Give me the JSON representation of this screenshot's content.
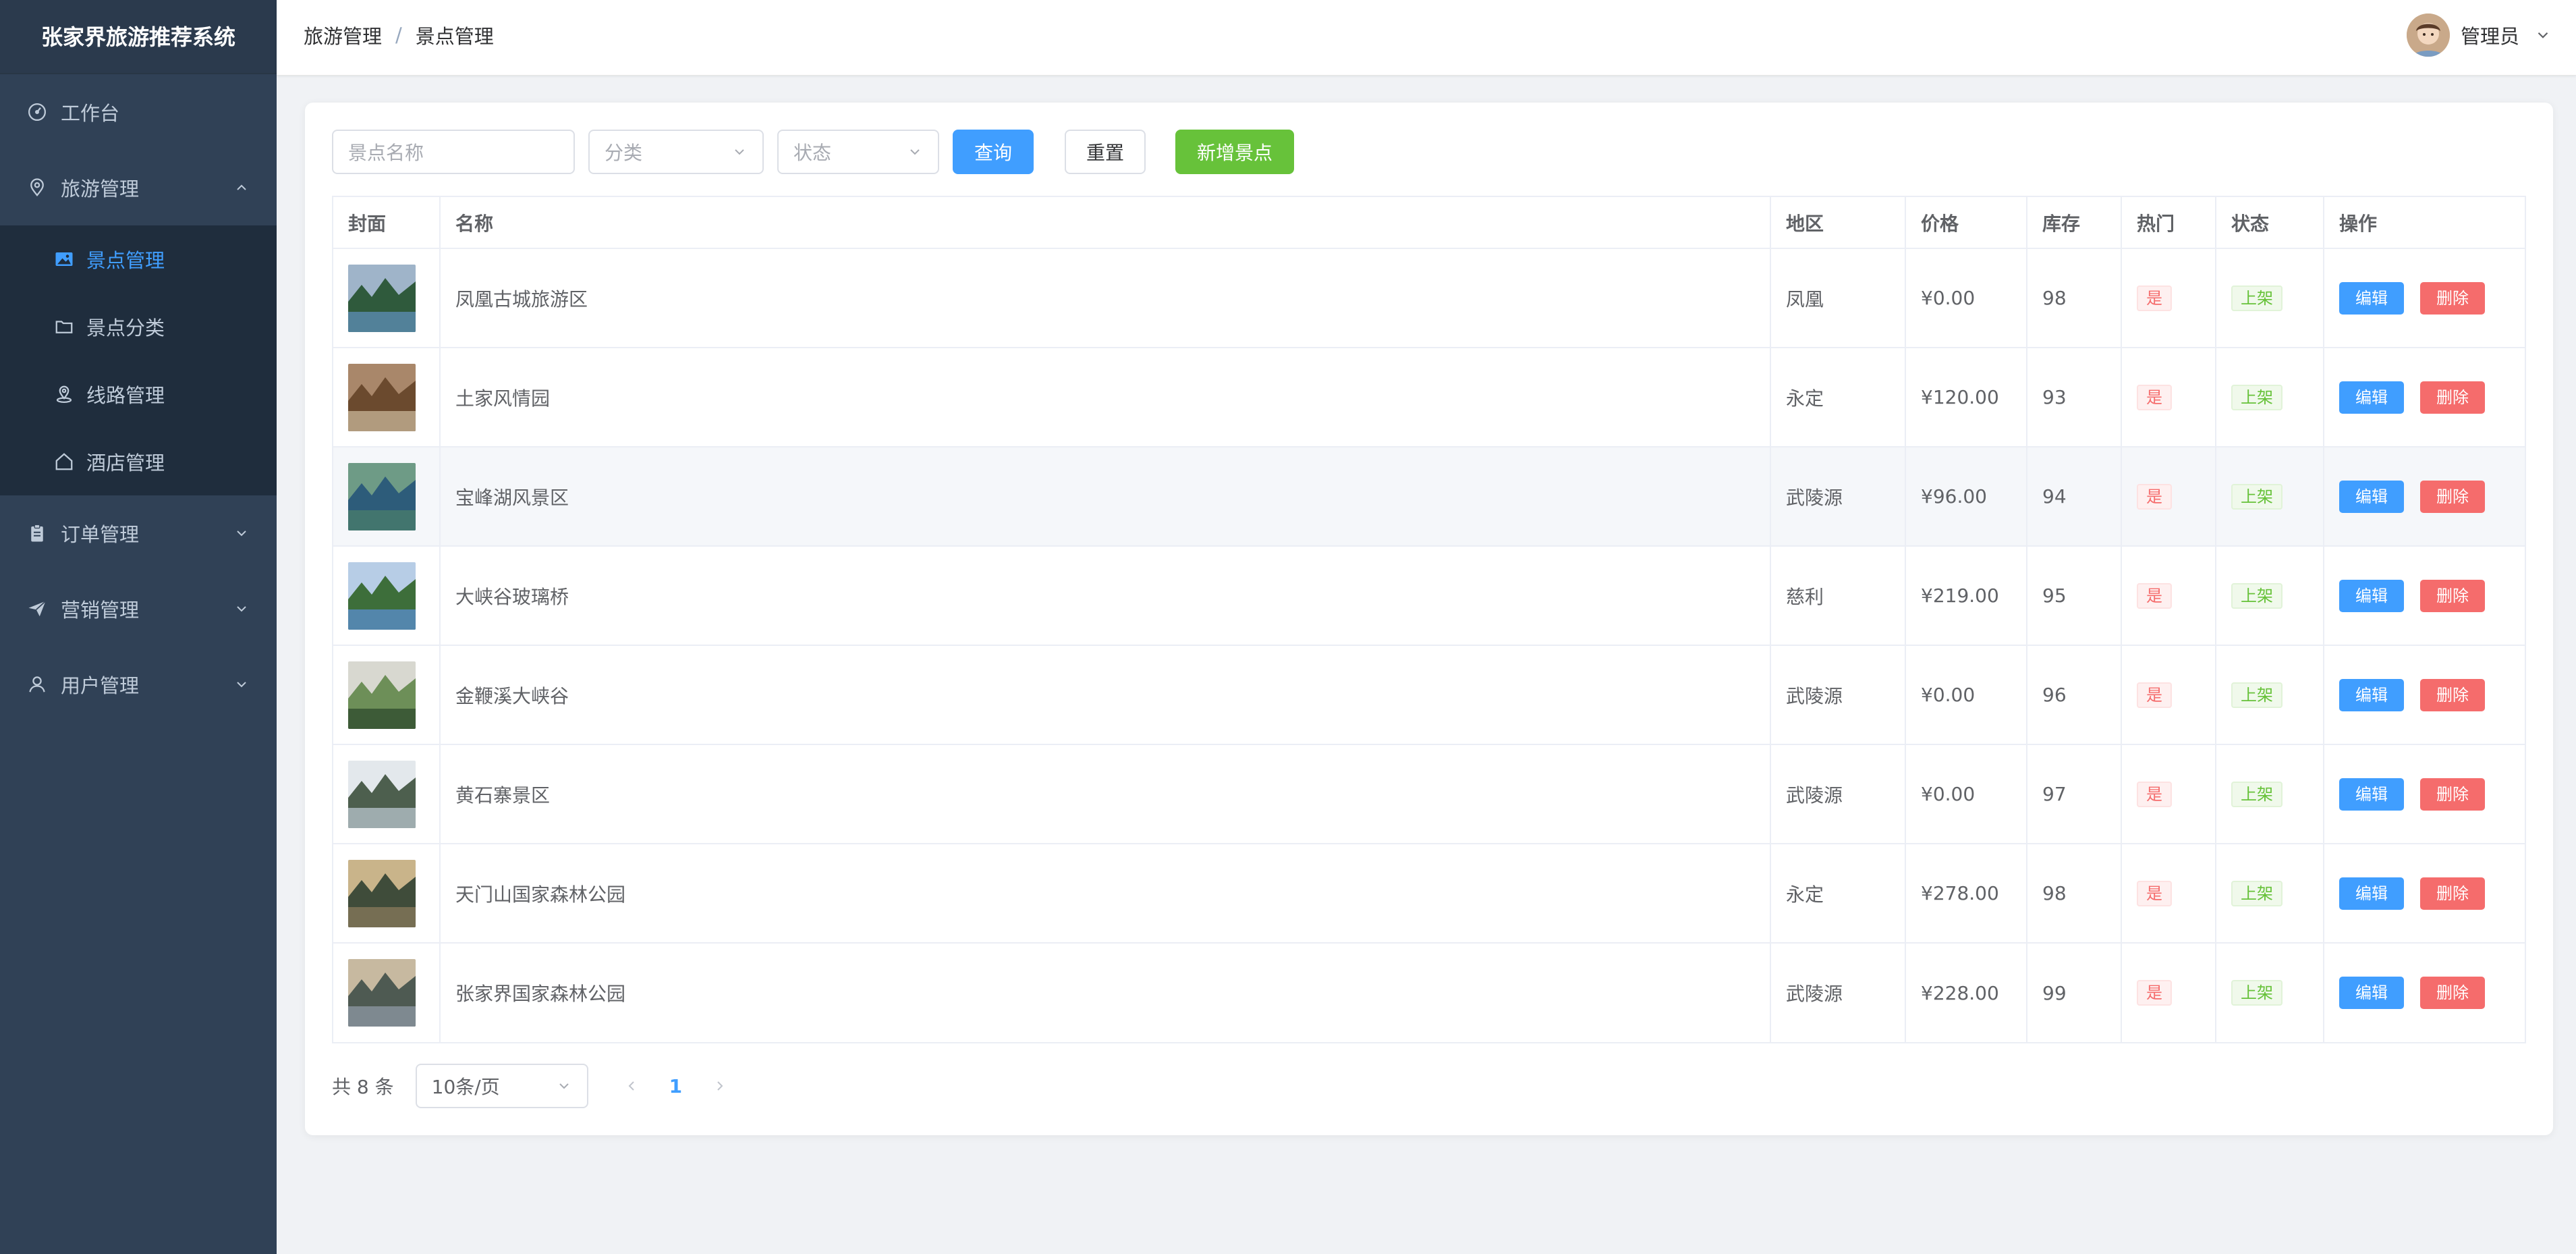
{
  "app": {
    "title": "张家界旅游推荐系统",
    "colors": {
      "sidebar": "#304156",
      "accent": "#409eff",
      "success": "#67c23a",
      "danger": "#f56c6c"
    }
  },
  "sidebar": {
    "items": [
      {
        "label": "工作台",
        "icon": "dashboard-icon"
      },
      {
        "label": "旅游管理",
        "icon": "location-pin-icon",
        "expanded": true,
        "children": [
          {
            "label": "景点管理",
            "icon": "picture-icon",
            "active": true
          },
          {
            "label": "景点分类",
            "icon": "folder-icon"
          },
          {
            "label": "线路管理",
            "icon": "map-location-icon"
          },
          {
            "label": "酒店管理",
            "icon": "house-icon"
          }
        ]
      },
      {
        "label": "订单管理",
        "icon": "clipboard-icon"
      },
      {
        "label": "营销管理",
        "icon": "paper-plane-icon"
      },
      {
        "label": "用户管理",
        "icon": "user-icon"
      }
    ]
  },
  "header": {
    "breadcrumb": [
      "旅游管理",
      "景点管理"
    ],
    "separator": "/",
    "user": {
      "name": "管理员"
    }
  },
  "filters": {
    "name_placeholder": "景点名称",
    "category_placeholder": "分类",
    "status_placeholder": "状态",
    "query_label": "查询",
    "reset_label": "重置",
    "add_label": "新增景点"
  },
  "table": {
    "columns": [
      "封面",
      "名称",
      "地区",
      "价格",
      "库存",
      "热门",
      "状态",
      "操作"
    ],
    "rows": [
      {
        "name": "凤凰古城旅游区",
        "region": "凤凰",
        "price": "¥0.00",
        "stock": "98",
        "hot": "是",
        "status": "上架",
        "cover": [
          "#5f8fb8",
          "#2f5a3c",
          "#9fb4c9"
        ]
      },
      {
        "name": "土家风情园",
        "region": "永定",
        "price": "¥120.00",
        "stock": "93",
        "hot": "是",
        "status": "上架",
        "cover": [
          "#c8b79a",
          "#6b4a2e",
          "#a9876a"
        ]
      },
      {
        "name": "宝峰湖风景区",
        "region": "武陵源",
        "price": "¥96.00",
        "stock": "94",
        "hot": "是",
        "status": "上架",
        "cover": [
          "#4a7d6b",
          "#2d5c7a",
          "#6e9b86"
        ]
      },
      {
        "name": "大峡谷玻璃桥",
        "region": "慈利",
        "price": "¥219.00",
        "stock": "95",
        "hot": "是",
        "status": "上架",
        "cover": [
          "#5b8fd1",
          "#3d6e3a",
          "#b7cde6"
        ]
      },
      {
        "name": "金鞭溪大峡谷",
        "region": "武陵源",
        "price": "¥0.00",
        "stock": "96",
        "hot": "是",
        "status": "上架",
        "cover": [
          "#2e4a2c",
          "#6d8f58",
          "#d8d8d0"
        ]
      },
      {
        "name": "黄石寨景区",
        "region": "武陵源",
        "price": "¥0.00",
        "stock": "97",
        "hot": "是",
        "status": "上架",
        "cover": [
          "#b9c6cf",
          "#4d5f4e",
          "#e3e8ec"
        ]
      },
      {
        "name": "天门山国家森林公园",
        "region": "永定",
        "price": "¥278.00",
        "stock": "98",
        "hot": "是",
        "status": "上架",
        "cover": [
          "#8a7a5c",
          "#3f4c3a",
          "#c9b48a"
        ]
      },
      {
        "name": "张家界国家森林公园",
        "region": "武陵源",
        "price": "¥228.00",
        "stock": "99",
        "hot": "是",
        "status": "上架",
        "cover": [
          "#8f9aa6",
          "#4e5a52",
          "#c7b9a0"
        ]
      }
    ],
    "highlighted_row": 2,
    "edit_label": "编辑",
    "delete_label": "删除"
  },
  "pagination": {
    "total_text": "共 8 条",
    "page_size": "10条/页",
    "current_page": "1"
  }
}
